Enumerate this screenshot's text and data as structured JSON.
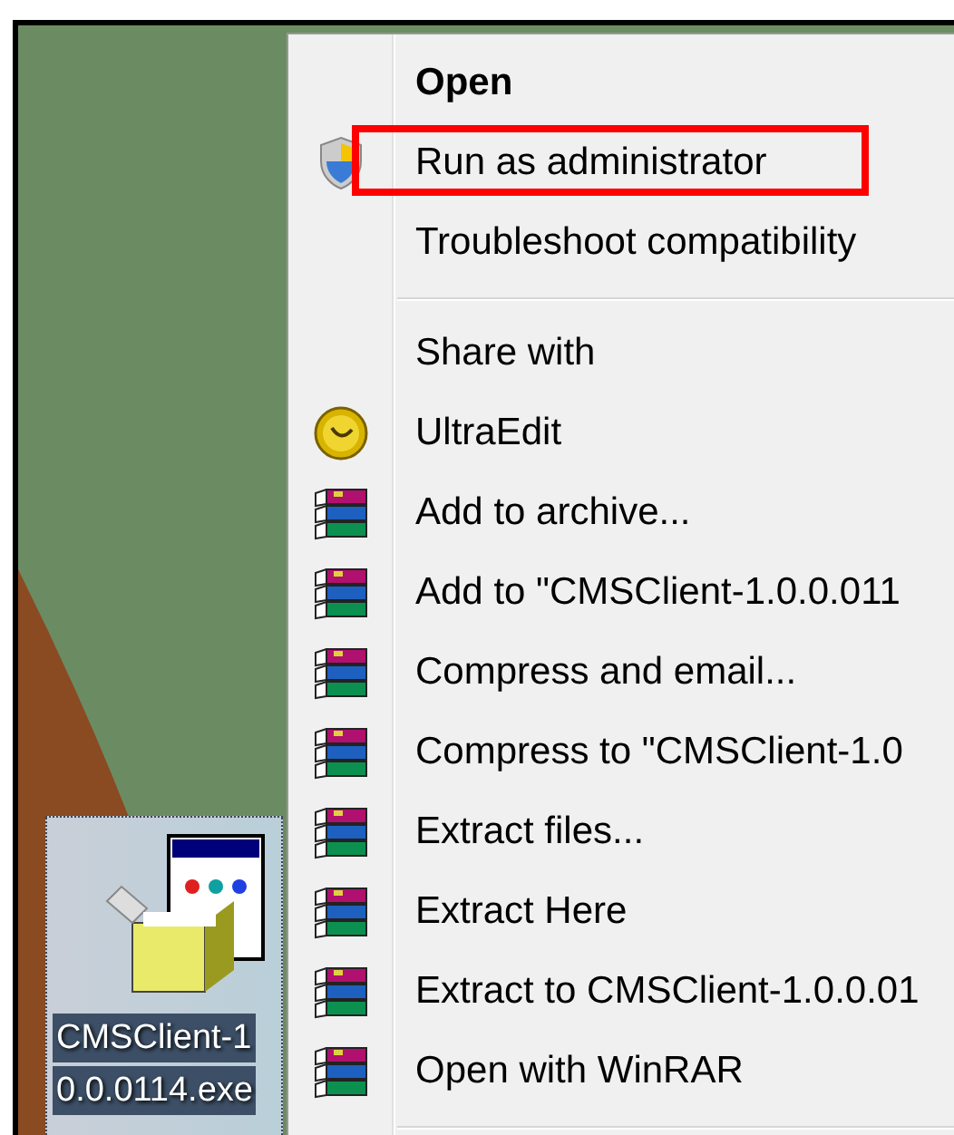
{
  "desktop_icon": {
    "label_lines": [
      "CMSClient-1",
      "0.0.0114.exe"
    ],
    "selected": true
  },
  "context_menu": {
    "items": [
      {
        "kind": "plain",
        "label": "Open",
        "default": true,
        "highlighted": false
      },
      {
        "kind": "admin",
        "label": "Run as administrator",
        "default": false,
        "highlighted": true
      },
      {
        "kind": "plain",
        "label": "Troubleshoot compatibility",
        "default": false,
        "highlighted": false
      },
      {
        "kind": "separator"
      },
      {
        "kind": "plain",
        "label": "Share with",
        "default": false,
        "highlighted": false
      },
      {
        "kind": "editor",
        "label": "UltraEdit",
        "default": false,
        "highlighted": false
      },
      {
        "kind": "archive",
        "label": "Add to archive...",
        "default": false,
        "highlighted": false
      },
      {
        "kind": "archive",
        "label": "Add to \"CMSClient-1.0.0.011",
        "default": false,
        "highlighted": false
      },
      {
        "kind": "archive",
        "label": "Compress and email...",
        "default": false,
        "highlighted": false
      },
      {
        "kind": "archive",
        "label": "Compress to \"CMSClient-1.0",
        "default": false,
        "highlighted": false
      },
      {
        "kind": "archive",
        "label": "Extract files...",
        "default": false,
        "highlighted": false
      },
      {
        "kind": "archive",
        "label": "Extract Here",
        "default": false,
        "highlighted": false
      },
      {
        "kind": "archive",
        "label": "Extract to CMSClient-1.0.0.01",
        "default": false,
        "highlighted": false
      },
      {
        "kind": "archive",
        "label": "Open with WinRAR",
        "default": false,
        "highlighted": false
      },
      {
        "kind": "separator"
      }
    ]
  }
}
